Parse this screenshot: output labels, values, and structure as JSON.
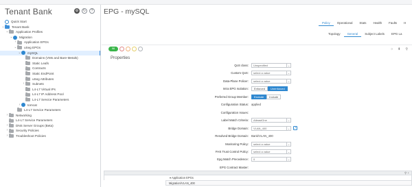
{
  "left_panel": {
    "title": "Tenant Bank",
    "actions": [
      "gear-icon",
      "refresh-icon",
      "help-icon"
    ],
    "tree": [
      {
        "label": "Quick Start",
        "indent": 1,
        "icon": "quick-start-icon",
        "expand": ""
      },
      {
        "label": "Tenant Bank",
        "indent": 1,
        "icon": "tenant-icon",
        "expand": "v"
      },
      {
        "label": "Application Profiles",
        "indent": 2,
        "icon": "folder-icon",
        "expand": "v"
      },
      {
        "label": "Migration",
        "indent": 3,
        "icon": "app-profile-icon",
        "expand": "v"
      },
      {
        "label": "Application EPGs",
        "indent": 4,
        "icon": "folder-icon",
        "expand": ">"
      },
      {
        "label": "uSeg EPGs",
        "indent": 4,
        "icon": "folder-icon",
        "expand": "v"
      },
      {
        "label": "mySQL",
        "indent": 5,
        "icon": "epg-icon",
        "expand": "v",
        "selected": true
      },
      {
        "label": "Domains (VMs and Bare-Metals)",
        "indent": 6,
        "icon": "folder-icon",
        "expand": ""
      },
      {
        "label": "Static Leafs",
        "indent": 6,
        "icon": "folder-icon",
        "expand": ""
      },
      {
        "label": "Contracts",
        "indent": 6,
        "icon": "folder-icon",
        "expand": ""
      },
      {
        "label": "Static EndPoint",
        "indent": 6,
        "icon": "folder-icon",
        "expand": ""
      },
      {
        "label": "uSeg Attributes",
        "indent": 6,
        "icon": "folder-icon",
        "expand": ""
      },
      {
        "label": "Subnets",
        "indent": 6,
        "icon": "folder-icon",
        "expand": ">"
      },
      {
        "label": "L4-L7 Virtual IPs",
        "indent": 6,
        "icon": "folder-icon",
        "expand": ""
      },
      {
        "label": "L4-L7 IP Address Pool",
        "indent": 6,
        "icon": "folder-icon",
        "expand": ""
      },
      {
        "label": "L4-L7 Service Parameters",
        "indent": 6,
        "icon": "folder-icon",
        "expand": ""
      },
      {
        "label": "tomcat",
        "indent": 5,
        "icon": "epg-icon",
        "expand": ">"
      },
      {
        "label": "L4-L7 Service Parameters",
        "indent": 4,
        "icon": "folder-icon",
        "expand": ""
      },
      {
        "label": "Networking",
        "indent": 2,
        "icon": "folder-icon",
        "expand": ">"
      },
      {
        "label": "L4-L7 Service Parameters",
        "indent": 2,
        "icon": "folder-icon",
        "expand": ""
      },
      {
        "label": "DNS Server Groups (Beta)",
        "indent": 2,
        "icon": "folder-icon",
        "expand": ">"
      },
      {
        "label": "Security Policies",
        "indent": 2,
        "icon": "folder-icon",
        "expand": ">"
      },
      {
        "label": "Troubleshoot Policies",
        "indent": 2,
        "icon": "folder-icon",
        "expand": ">"
      }
    ]
  },
  "main": {
    "title": "EPG - mySQL",
    "tabs": [
      {
        "label": "Policy",
        "active": true
      },
      {
        "label": "Operational",
        "active": false
      },
      {
        "label": "Stats",
        "active": false
      },
      {
        "label": "Health",
        "active": false
      },
      {
        "label": "Faults",
        "active": false
      },
      {
        "label": "H",
        "active": false
      }
    ],
    "sub_tabs": [
      {
        "label": "Topology",
        "active": false
      },
      {
        "label": "General",
        "active": true
      },
      {
        "label": "Subject Labels",
        "active": false
      },
      {
        "label": "EPG La",
        "active": false
      }
    ],
    "health_badge": "98",
    "tools": [
      "○",
      "⬆",
      "⚲"
    ],
    "section_title": "Properties",
    "fields": [
      {
        "label": "QoS class:",
        "type": "select",
        "value": "Unspecified"
      },
      {
        "label": "Custom QoS:",
        "type": "select",
        "value": "select a value"
      },
      {
        "label": "Data-Plane Policer:",
        "type": "select",
        "value": "select a value"
      },
      {
        "label": "Intra EPG Isolation:",
        "type": "segmented",
        "options": [
          "Enforced",
          "Unenforced"
        ],
        "active": 1
      },
      {
        "label": "Preferred Group Member:",
        "type": "segmented",
        "options": [
          "Exclude",
          "Include"
        ],
        "active": 0
      },
      {
        "label": "Configuration Status:",
        "type": "text",
        "value": "applied"
      },
      {
        "label": "Configuration Issues:",
        "type": "text",
        "value": ""
      },
      {
        "label": "Label Match Criteria:",
        "type": "select",
        "value": "AtleastOne"
      },
      {
        "label": "Bridge Domain:",
        "type": "select-link",
        "value": "VLAN_400"
      },
      {
        "label": "Resolved Bridge Domain:",
        "type": "text",
        "value": "Bank/VLAN_400"
      },
      {
        "label": "Monitoring Policy:",
        "type": "select",
        "value": "select a value"
      },
      {
        "label": "FHS Trust Control Policy:",
        "type": "select",
        "value": "select a value"
      },
      {
        "label": "Epg Match Precedence:",
        "type": "select",
        "value": "0"
      },
      {
        "label": "EPG Contract Master:",
        "type": "text",
        "value": ""
      }
    ],
    "table": {
      "header_icons": "⚲ +",
      "column": "▾ Application EPGs",
      "row": "Migration/VLAN_400"
    }
  }
}
